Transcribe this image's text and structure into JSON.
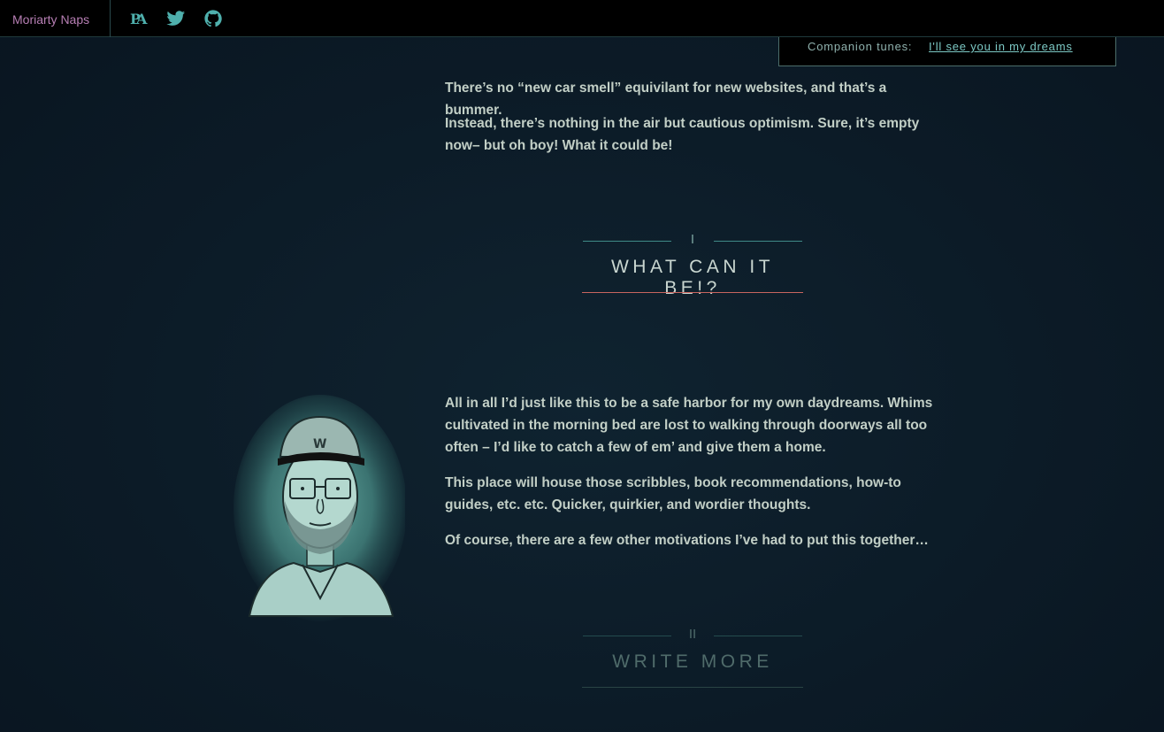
{
  "header": {
    "brand": "Moriarty Naps",
    "social": [
      {
        "name": "patreon-icon"
      },
      {
        "name": "twitter-icon"
      },
      {
        "name": "github-icon"
      }
    ],
    "accent_color": "#7cc8c4",
    "brand_color": "#b77fb4"
  },
  "companion": {
    "label": "Companion tunes:",
    "link": "I'll see you in my dreams"
  },
  "intro": {
    "p1": "There’s no “new car smell” equivilant for new websites, and that’s a bummer.",
    "p2": "Instead, there’s nothing in the air but cautious optimism. Sure, it’s empty now– but oh boy! What it could be!"
  },
  "section1": {
    "numeral": "I",
    "title": "WHAT CAN IT BE!?",
    "p1": "All in all I’d just like this to be a safe harbor for my own daydreams. Whims cultivated in the morning bed are lost to walking through doorways all too often – I’d like to catch a few of em’ and give them a home.",
    "p2": "This place will house those scribbles, book recommendations, how-to guides, etc. etc. Quicker, quirkier, and wordier thoughts.",
    "p3": "Of course, there are a few other motivations I’ve had to put this together…"
  },
  "section2": {
    "numeral": "II",
    "title": "WRITE MORE"
  }
}
